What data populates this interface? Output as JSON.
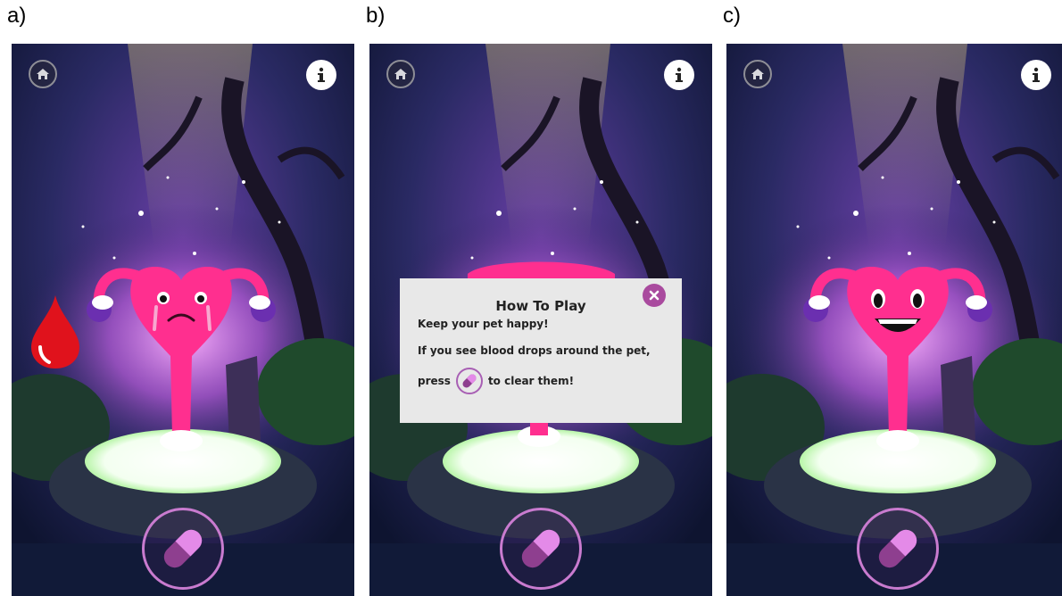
{
  "panels": [
    {
      "label": "a)",
      "state": "sad",
      "pet_name_icon": "pet-uterus-sad-icon"
    },
    {
      "label": "b)",
      "state": "how-to-play"
    },
    {
      "label": "c)",
      "state": "happy",
      "pet_name_icon": "pet-uterus-happy-icon"
    }
  ],
  "dialog": {
    "title": "How To Play",
    "line1": "Keep your pet happy!",
    "line2": "If you see blood drops around the pet,",
    "line3_before": "press",
    "line3_after": "to clear them!"
  },
  "icons": {
    "home": "home-icon",
    "info": "info-icon",
    "pill": "pill-icon",
    "close": "close-icon",
    "blood": "blood-drop-icon"
  },
  "colors": {
    "pet_pink": "#ff2f8f",
    "pill_light": "#e48ae8",
    "pill_dark": "#8e3f8f",
    "pill_ring": "#c97bcf",
    "blood": "#e0121c",
    "dialog_bg": "#e8e8e8",
    "close_bg": "#a94a9e"
  }
}
